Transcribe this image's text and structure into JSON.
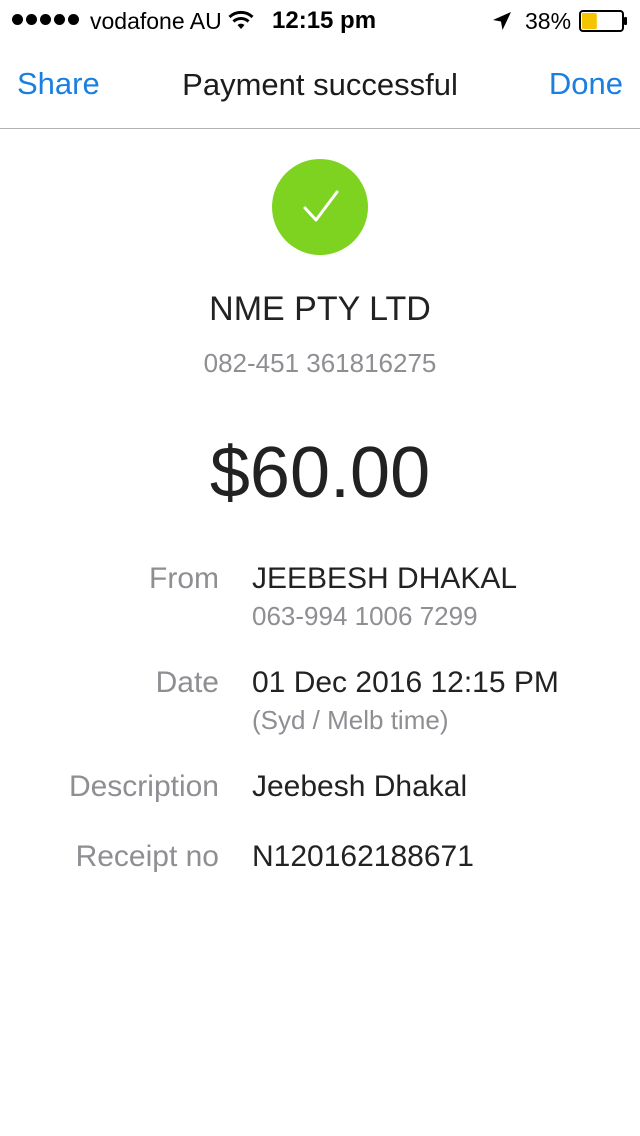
{
  "status_bar": {
    "carrier": "vodafone AU",
    "time": "12:15 pm",
    "battery_percent": "38%",
    "battery_level": 0.38,
    "signal_bars": 5,
    "icons": [
      "signal-dots-icon",
      "wifi-icon",
      "location-arrow-icon",
      "battery-icon"
    ]
  },
  "nav": {
    "left_label": "Share",
    "title": "Payment successful",
    "right_label": "Done"
  },
  "payment": {
    "status_icon": "checkmark-icon",
    "payee_name": "NME PTY LTD",
    "payee_account": "082-451 361816275",
    "amount": "$60.00",
    "details": {
      "from_label": "From",
      "from_name": "JEEBESH DHAKAL",
      "from_account": "063-994 1006 7299",
      "date_label": "Date",
      "date_value": "01 Dec 2016 12:15 PM",
      "date_timezone": "(Syd / Melb time)",
      "description_label": "Description",
      "description_value": "Jeebesh Dhakal",
      "receipt_label": "Receipt no",
      "receipt_value": "N120162188671"
    }
  },
  "colors": {
    "accent": "#1a7fe0",
    "success": "#7ed321",
    "battery": "#f5c400"
  }
}
